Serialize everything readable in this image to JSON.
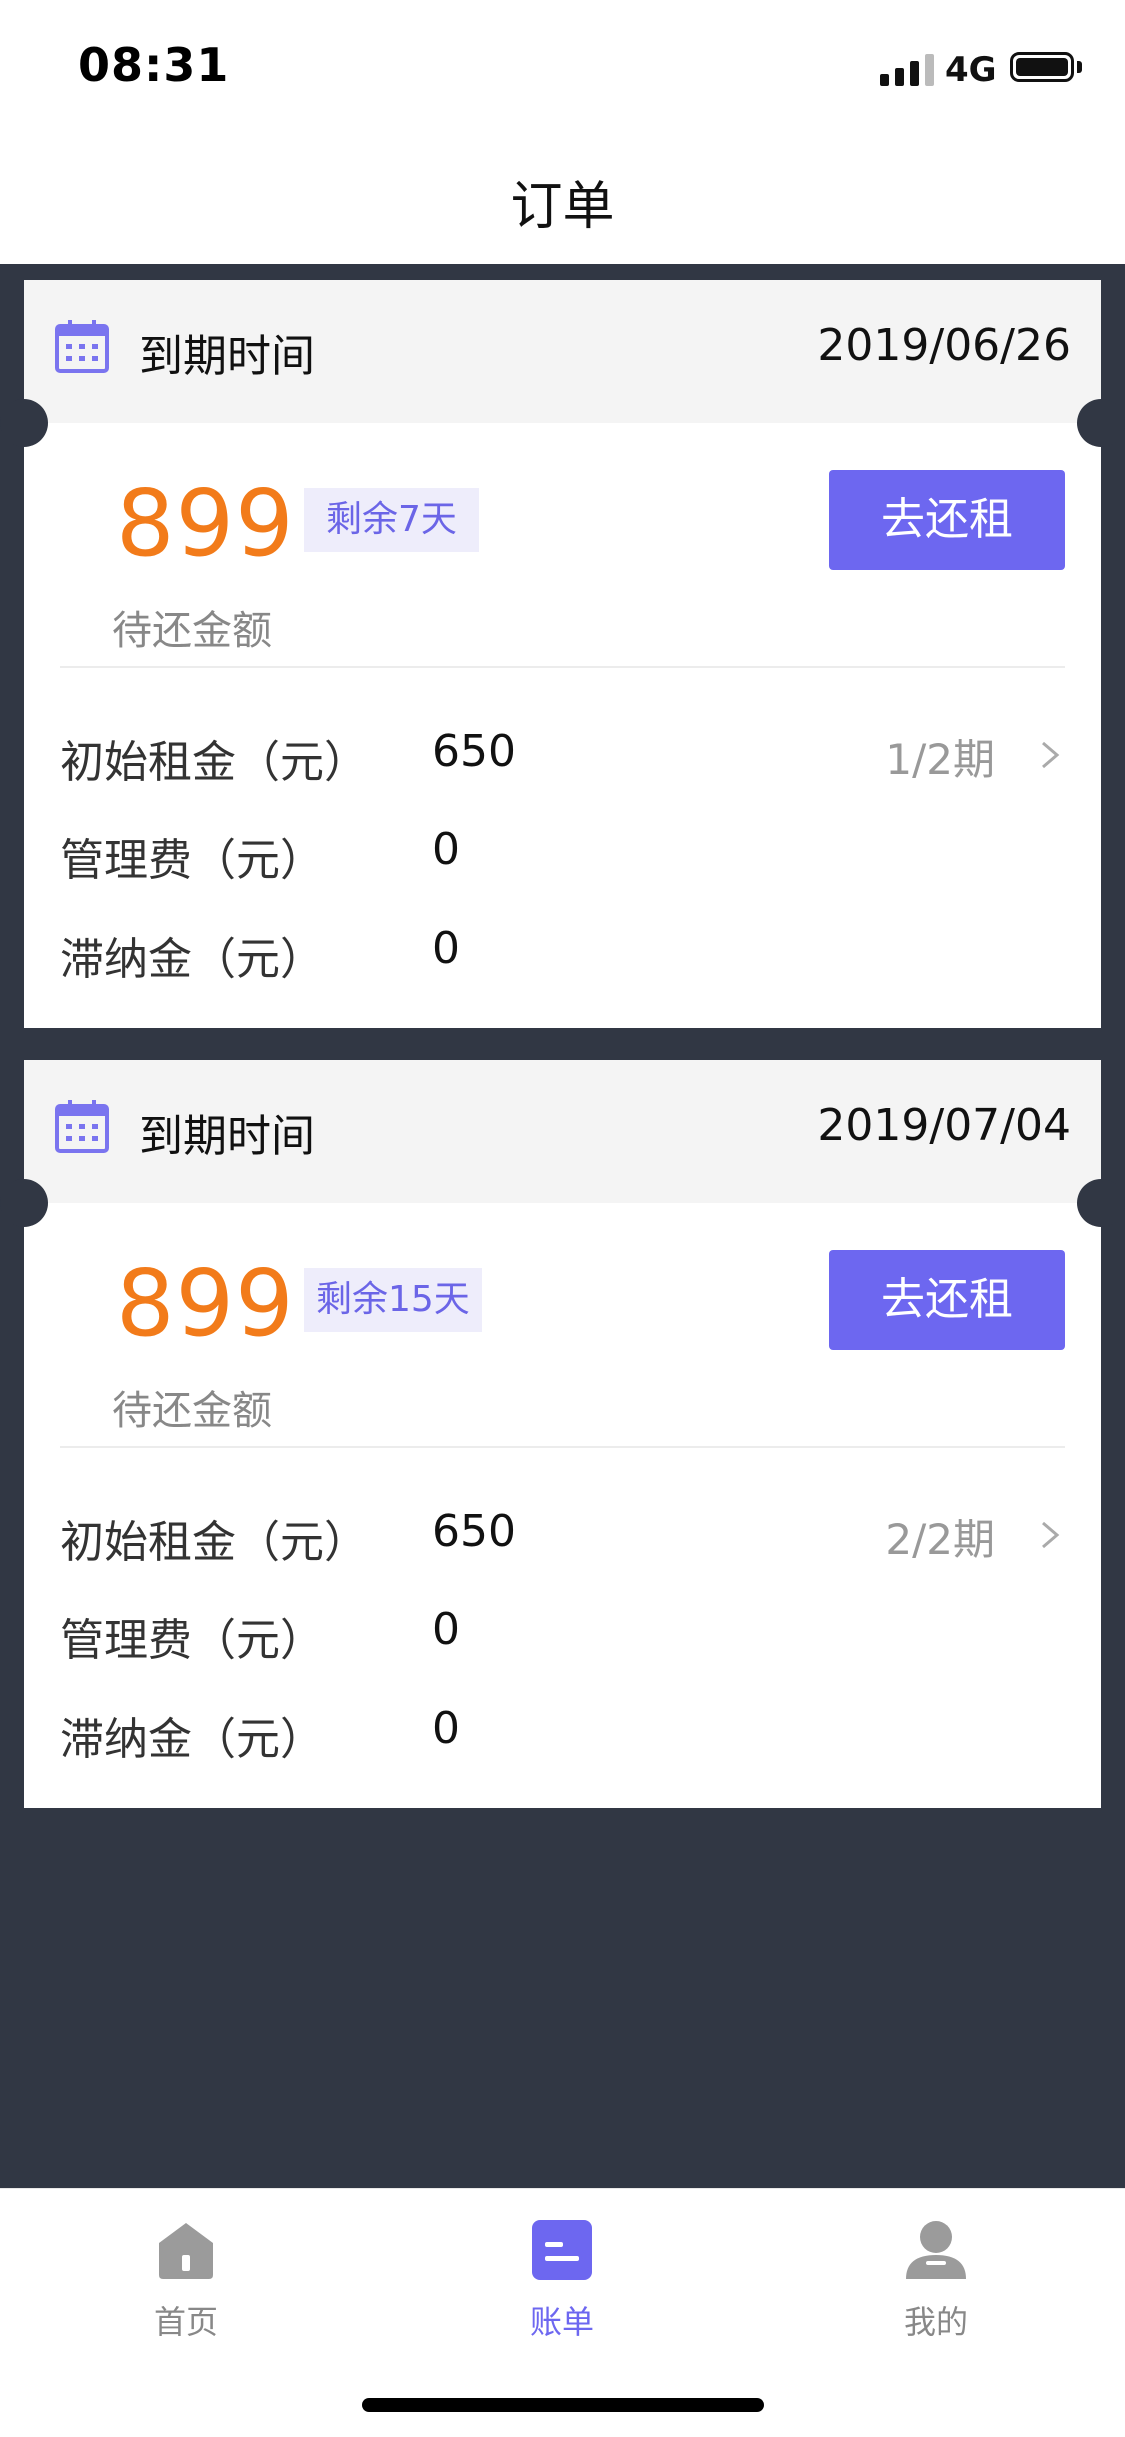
{
  "status_bar": {
    "time": "08:31",
    "network": "4G"
  },
  "nav": {
    "title": "订单"
  },
  "orders": [
    {
      "header_label": "到期时间",
      "due_date": "2019/06/26",
      "amount": "899",
      "remaining": "剩余7天",
      "amount_label": "待还金额",
      "pay_button": "去还租",
      "rows": [
        {
          "label": "初始租金（元）",
          "value": "650",
          "period": "1/2期"
        },
        {
          "label": "管理费（元）",
          "value": "0"
        },
        {
          "label": "滞纳金（元）",
          "value": "0"
        }
      ]
    },
    {
      "header_label": "到期时间",
      "due_date": "2019/07/04",
      "amount": "899",
      "remaining": "剩余15天",
      "amount_label": "待还金额",
      "pay_button": "去还租",
      "rows": [
        {
          "label": "初始租金（元）",
          "value": "650",
          "period": "2/2期"
        },
        {
          "label": "管理费（元）",
          "value": "0"
        },
        {
          "label": "滞纳金（元）",
          "value": "0"
        }
      ]
    }
  ],
  "tab_bar": {
    "tabs": [
      {
        "label": "首页",
        "icon": "home-icon"
      },
      {
        "label": "账单",
        "icon": "bill-icon"
      },
      {
        "label": "我的",
        "icon": "profile-icon"
      }
    ],
    "active": "账单"
  },
  "colors": {
    "accent": "#6d67f0",
    "amount": "#f27b1a",
    "background": "#313744",
    "badge_bg": "#eeedfb"
  }
}
